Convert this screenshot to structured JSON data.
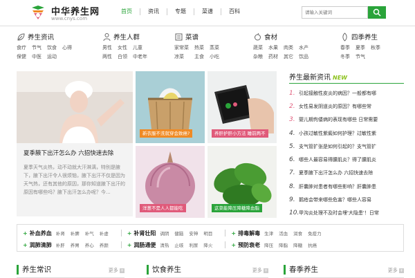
{
  "header": {
    "site_name": "中华养生网",
    "site_url": "www.cnys.com",
    "nav": [
      "首页",
      "资讯",
      "专题",
      "菜谱",
      "百科"
    ],
    "search_placeholder": "请输入关键词"
  },
  "categories": [
    {
      "title": "养生资讯",
      "links": [
        "食疗",
        "节气",
        "饮食",
        "心得",
        "保健",
        "中医",
        "运动",
        "",
        "",
        "",
        "",
        ""
      ]
    },
    {
      "title": "养生人群",
      "links": [
        "男性",
        "女性",
        "儿童",
        "两性",
        "白领",
        "中老年",
        "",
        "",
        "",
        "",
        "",
        ""
      ]
    },
    {
      "title": "菜谱",
      "links": [
        "家常菜",
        "热菜",
        "蒸菜",
        "凉菜",
        "主食",
        "小吃",
        "",
        "",
        "",
        "",
        "",
        ""
      ]
    },
    {
      "title": "食材",
      "links": [
        "蔬菜",
        "水果",
        "肉类",
        "水产",
        "杂粮",
        "药材",
        "其它",
        "饮品",
        "",
        "",
        "",
        ""
      ]
    },
    {
      "title": "四季养生",
      "links": [
        "春季",
        "夏季",
        "秋季",
        "冬季",
        "节气",
        "",
        "",
        "",
        "",
        "",
        "",
        ""
      ]
    }
  ],
  "feature": {
    "title": "夏季腋下出汗怎么办 六招快速去除",
    "desc": "夏季天气炎热，动不动就大汗淋漓，特别是腋下，腋下出汗令人很烦恼，腋下出汗不仅是因为天气热，还有其他的原因，那你知道腋下出汗的原因有哪些吗？腋下出汗怎么办呢？今..."
  },
  "tiles": [
    {
      "caption": "新衣服不洗就穿会致癌?"
    },
    {
      "caption": "养肝护肝小方法 睡前两不"
    },
    {
      "caption": "洋葱不是人人都能吃"
    },
    {
      "caption": "这菜能降压降糖降血脂"
    }
  ],
  "news": {
    "title": "养生最新资讯",
    "badge": "NEW",
    "items": [
      {
        "num": "1.",
        "text": "引起接触性皮炎的病因？一般都有哪"
      },
      {
        "num": "2.",
        "text": "女性易发阴道炎的原因？有哪些常"
      },
      {
        "num": "3.",
        "text": "婴儿期佝偻病的表现有哪些 日常需要"
      },
      {
        "num": "4.",
        "text": "小孩过敏性紫癜如何护理？过敏性紫"
      },
      {
        "num": "5.",
        "text": "支气管扩张是如何引起的？支气管扩"
      },
      {
        "num": "6.",
        "text": "哪些人最容易得腰肌炎？得了腰肌炎"
      },
      {
        "num": "7.",
        "text": "夏季腋下出汗怎么办 六招快速去除"
      },
      {
        "num": "8.",
        "text": "肝囊肿对患者有哪些影响？肝囊肿患"
      },
      {
        "num": "9.",
        "text": "鹅疮会带来哪些危害？哪些人容易"
      },
      {
        "num": "10.",
        "text": "甲沟炎处理不及时会埋'大隐患'！日常"
      }
    ]
  },
  "tag_rows": [
    [
      {
        "title": "补血养血",
        "links": [
          "补肾",
          "补脾",
          "补气",
          "补虚"
        ]
      },
      {
        "title": "补肾壮阳",
        "links": [
          "调阴",
          "健脑",
          "安神",
          "明目"
        ]
      },
      {
        "title": "排毒解毒",
        "links": [
          "生津",
          "活血",
          "润食",
          "免疫力"
        ]
      }
    ],
    [
      {
        "title": "润肺清肺",
        "links": [
          "补肝",
          "养胃",
          "养心",
          "养颜"
        ]
      },
      {
        "title": "润肠通便",
        "links": [
          "清热",
          "止咳",
          "利尿",
          "降火"
        ]
      },
      {
        "title": "预防衰老",
        "links": [
          "降压",
          "降脂",
          "降糖",
          "抗癌"
        ]
      }
    ]
  ],
  "sections": [
    {
      "title": "养生常识",
      "more": "更多"
    },
    {
      "title": "饮食养生",
      "more": "更多"
    },
    {
      "title": "春季养生",
      "more": "更多"
    }
  ],
  "colors": {
    "brand": "#2aa43a",
    "accent": "#e05a7a",
    "new": "#8dc21f"
  }
}
